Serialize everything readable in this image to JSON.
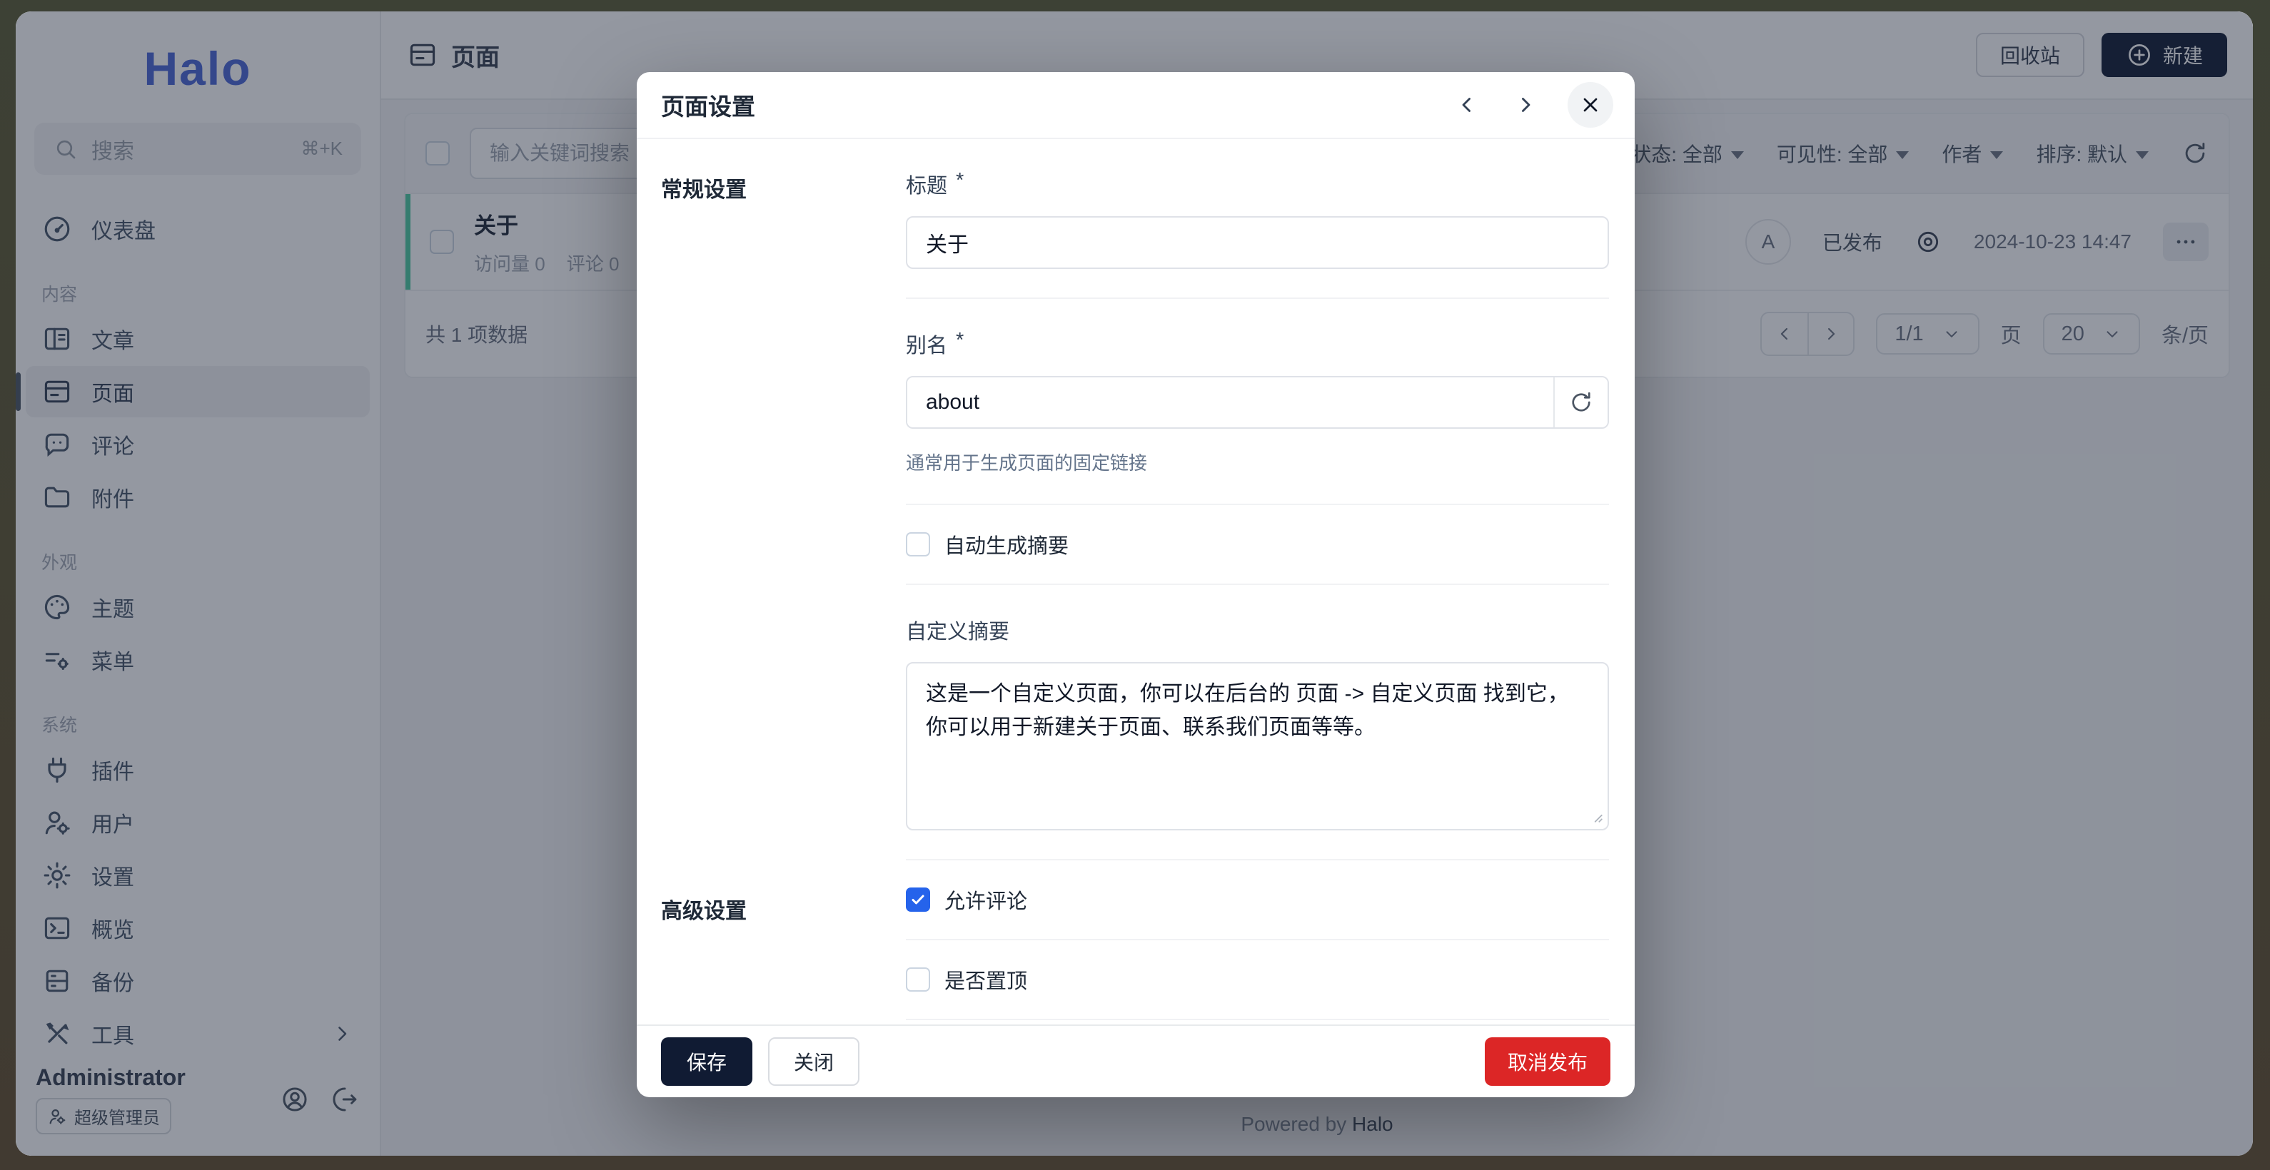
{
  "colors": {
    "accent_blue": "#2563eb",
    "primary_dark": "#101b33",
    "danger_red": "#dc2626",
    "brand_blue": "#4a66d6",
    "row_accent_teal": "#4ccba0",
    "backdrop": "rgba(27,37,56,0.47)"
  },
  "sidebar": {
    "logo": "Halo",
    "search": {
      "placeholder": "搜索",
      "shortcut": "⌘+K"
    },
    "dashboard": {
      "label": "仪表盘"
    },
    "sections": [
      {
        "label": "内容",
        "items": [
          {
            "label": "文章"
          },
          {
            "label": "页面"
          },
          {
            "label": "评论"
          },
          {
            "label": "附件"
          }
        ]
      },
      {
        "label": "外观",
        "items": [
          {
            "label": "主题"
          },
          {
            "label": "菜单"
          }
        ]
      },
      {
        "label": "系统",
        "items": [
          {
            "label": "插件"
          },
          {
            "label": "用户"
          },
          {
            "label": "设置"
          },
          {
            "label": "概览"
          },
          {
            "label": "备份"
          },
          {
            "label": "工具"
          }
        ]
      }
    ],
    "user": {
      "name": "Administrator",
      "role": "超级管理员"
    }
  },
  "header": {
    "title": "页面",
    "recycle": "回收站",
    "create": "新建"
  },
  "toolbar": {
    "search_placeholder": "输入关键词搜索",
    "filters": [
      {
        "label": "状态: 全部"
      },
      {
        "label": "可见性: 全部"
      },
      {
        "label": "作者"
      },
      {
        "label": "排序: 默认"
      }
    ]
  },
  "list": {
    "total": "共 1 项数据",
    "row": {
      "title": "关于",
      "visits_label": "访问量",
      "visits": "0",
      "comments_label": "评论",
      "comments": "0",
      "avatar": "A",
      "status": "已发布",
      "datetime": "2024-10-23 14:47",
      "checked": false
    }
  },
  "pagination": {
    "page": "1/1",
    "page_unit": "页",
    "size": "20",
    "size_unit": "条/页"
  },
  "modal": {
    "title": "页面设置",
    "sections": {
      "general": "常规设置",
      "advanced": "高级设置"
    },
    "fields": {
      "title": {
        "label": "标题",
        "required": "*",
        "value": "关于"
      },
      "slug": {
        "label": "别名",
        "required": "*",
        "value": "about",
        "help": "通常用于生成页面的固定链接"
      },
      "auto_excerpt": {
        "label": "自动生成摘要",
        "checked": false
      },
      "excerpt": {
        "label": "自定义摘要",
        "value": "这是一个自定义页面，你可以在后台的 页面 -> 自定义页面 找到它，你可以用于新建关于页面、联系我们页面等等。"
      },
      "allow_comment": {
        "label": "允许评论",
        "checked": true
      },
      "pinned": {
        "label": "是否置顶",
        "checked": false
      }
    },
    "footer": {
      "save": "保存",
      "close": "关闭",
      "cancel_publish": "取消发布"
    }
  },
  "footer": {
    "powered_by": "Powered by",
    "brand": "Halo"
  }
}
